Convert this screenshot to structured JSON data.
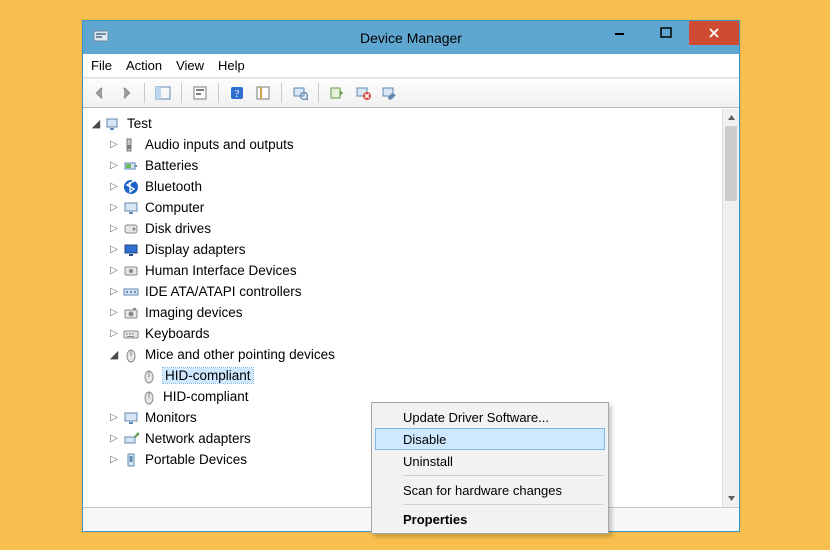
{
  "titlebar": {
    "title": "Device Manager"
  },
  "menus": {
    "file": "File",
    "action": "Action",
    "view": "View",
    "help": "Help"
  },
  "tree": {
    "root": "Test",
    "categories": [
      {
        "label": "Audio inputs and outputs",
        "exp": "▷",
        "icon": "speaker"
      },
      {
        "label": "Batteries",
        "exp": "▷",
        "icon": "battery"
      },
      {
        "label": "Bluetooth",
        "exp": "▷",
        "icon": "bluetooth"
      },
      {
        "label": "Computer",
        "exp": "▷",
        "icon": "computer"
      },
      {
        "label": "Disk drives",
        "exp": "▷",
        "icon": "disk"
      },
      {
        "label": "Display adapters",
        "exp": "▷",
        "icon": "display"
      },
      {
        "label": "Human Interface Devices",
        "exp": "▷",
        "icon": "hid"
      },
      {
        "label": "IDE ATA/ATAPI controllers",
        "exp": "▷",
        "icon": "ide"
      },
      {
        "label": "Imaging devices",
        "exp": "▷",
        "icon": "imaging"
      },
      {
        "label": "Keyboards",
        "exp": "▷",
        "icon": "keyboard"
      },
      {
        "label": "Mice and other pointing devices",
        "exp": "◢",
        "icon": "mouse",
        "children": [
          {
            "label": "HID-compliant",
            "icon": "mouse",
            "selected": true
          },
          {
            "label": "HID-compliant",
            "icon": "mouse"
          }
        ]
      },
      {
        "label": "Monitors",
        "exp": "▷",
        "icon": "monitor"
      },
      {
        "label": "Network adapters",
        "exp": "▷",
        "icon": "network"
      },
      {
        "label": "Portable Devices",
        "exp": "▷",
        "icon": "portable"
      }
    ]
  },
  "context_menu": {
    "update": "Update Driver Software...",
    "disable": "Disable",
    "uninstall": "Uninstall",
    "scan": "Scan for hardware changes",
    "properties": "Properties"
  }
}
